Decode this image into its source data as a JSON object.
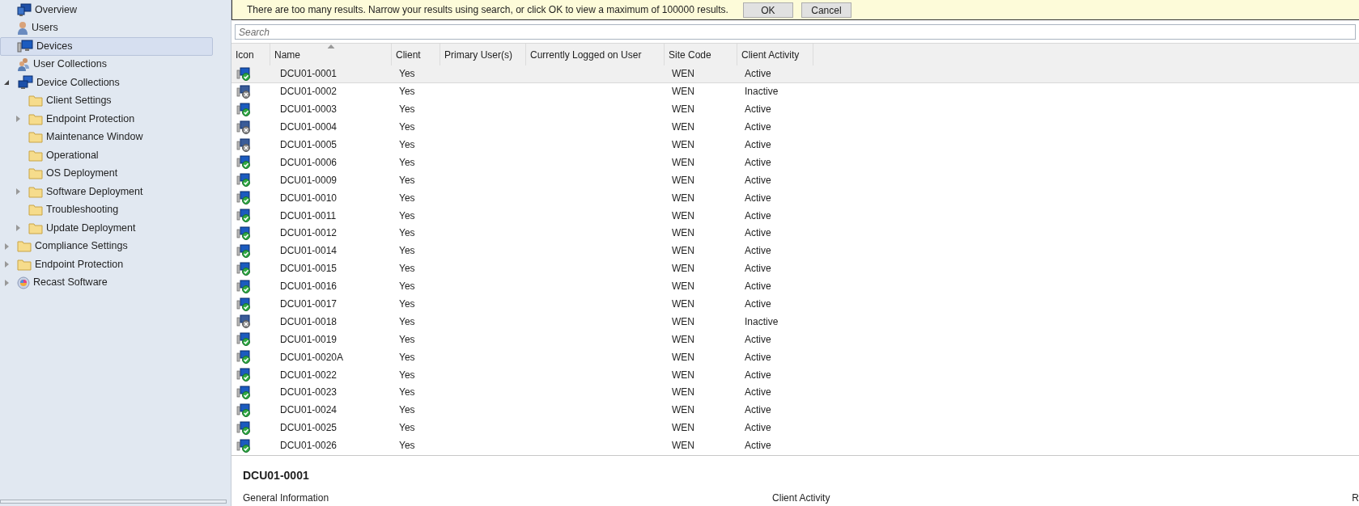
{
  "sidebar": {
    "items": [
      {
        "label": "Overview",
        "kind": "overview",
        "selected": false
      },
      {
        "label": "Users",
        "kind": "user",
        "selected": false
      },
      {
        "label": "Devices",
        "kind": "device",
        "selected": true
      },
      {
        "label": "User Collections",
        "kind": "user-collection",
        "selected": false
      },
      {
        "label": "Device Collections",
        "kind": "device-collection",
        "selected": false,
        "expanded": true,
        "children": [
          {
            "label": "Client Settings",
            "kind": "folder",
            "selected": false
          },
          {
            "label": "Endpoint Protection",
            "kind": "folder",
            "selected": false,
            "expanded": false
          },
          {
            "label": "Maintenance Window",
            "kind": "folder",
            "selected": false
          },
          {
            "label": "Operational",
            "kind": "folder",
            "selected": false
          },
          {
            "label": "OS Deployment",
            "kind": "folder",
            "selected": false
          },
          {
            "label": "Software Deployment",
            "kind": "folder",
            "selected": false,
            "expanded": false
          },
          {
            "label": "Troubleshooting",
            "kind": "folder",
            "selected": false
          },
          {
            "label": "Update Deployment",
            "kind": "folder",
            "selected": false,
            "expanded": false
          }
        ]
      },
      {
        "label": "Compliance Settings",
        "kind": "folder",
        "selected": false,
        "expanded": false
      },
      {
        "label": "Endpoint Protection",
        "kind": "folder",
        "selected": false,
        "expanded": false
      },
      {
        "label": "Recast Software",
        "kind": "recast",
        "selected": false,
        "expanded": false
      }
    ]
  },
  "notice": {
    "message": "There are too many results. Narrow your results using search, or click OK to view a maximum of 100000 results.",
    "buttons": [
      "OK",
      "Cancel"
    ]
  },
  "search": {
    "placeholder": "Search"
  },
  "table": {
    "columns": [
      {
        "label": "Icon",
        "sorted": false
      },
      {
        "label": "Name",
        "sorted": true
      },
      {
        "label": "Client",
        "sorted": false
      },
      {
        "label": "Primary User(s)",
        "sorted": false
      },
      {
        "label": "Currently Logged on User",
        "sorted": false
      },
      {
        "label": "Site Code",
        "sorted": false
      },
      {
        "label": "Client Activity",
        "sorted": false
      }
    ],
    "rows": [
      {
        "kind": "ok",
        "name": "DCU01-0001",
        "client": "Yes",
        "site_code": "WEN",
        "client_activity": "Active",
        "selected": true
      },
      {
        "kind": "error",
        "name": "DCU01-0002",
        "client": "Yes",
        "site_code": "WEN",
        "client_activity": "Inactive",
        "selected": false
      },
      {
        "kind": "ok",
        "name": "DCU01-0003",
        "client": "Yes",
        "site_code": "WEN",
        "client_activity": "Active",
        "selected": false
      },
      {
        "kind": "error",
        "name": "DCU01-0004",
        "client": "Yes",
        "site_code": "WEN",
        "client_activity": "Active",
        "selected": false
      },
      {
        "kind": "error",
        "name": "DCU01-0005",
        "client": "Yes",
        "site_code": "WEN",
        "client_activity": "Active",
        "selected": false
      },
      {
        "kind": "ok",
        "name": "DCU01-0006",
        "client": "Yes",
        "site_code": "WEN",
        "client_activity": "Active",
        "selected": false
      },
      {
        "kind": "ok",
        "name": "DCU01-0009",
        "client": "Yes",
        "site_code": "WEN",
        "client_activity": "Active",
        "selected": false
      },
      {
        "kind": "ok",
        "name": "DCU01-0010",
        "client": "Yes",
        "site_code": "WEN",
        "client_activity": "Active",
        "selected": false
      },
      {
        "kind": "ok",
        "name": "DCU01-0011",
        "client": "Yes",
        "site_code": "WEN",
        "client_activity": "Active",
        "selected": false
      },
      {
        "kind": "ok",
        "name": "DCU01-0012",
        "client": "Yes",
        "site_code": "WEN",
        "client_activity": "Active",
        "selected": false
      },
      {
        "kind": "ok",
        "name": "DCU01-0014",
        "client": "Yes",
        "site_code": "WEN",
        "client_activity": "Active",
        "selected": false
      },
      {
        "kind": "ok",
        "name": "DCU01-0015",
        "client": "Yes",
        "site_code": "WEN",
        "client_activity": "Active",
        "selected": false
      },
      {
        "kind": "ok",
        "name": "DCU01-0016",
        "client": "Yes",
        "site_code": "WEN",
        "client_activity": "Active",
        "selected": false
      },
      {
        "kind": "ok",
        "name": "DCU01-0017",
        "client": "Yes",
        "site_code": "WEN",
        "client_activity": "Active",
        "selected": false
      },
      {
        "kind": "error",
        "name": "DCU01-0018",
        "client": "Yes",
        "site_code": "WEN",
        "client_activity": "Inactive",
        "selected": false
      },
      {
        "kind": "ok",
        "name": "DCU01-0019",
        "client": "Yes",
        "site_code": "WEN",
        "client_activity": "Active",
        "selected": false
      },
      {
        "kind": "ok",
        "name": "DCU01-0020A",
        "client": "Yes",
        "site_code": "WEN",
        "client_activity": "Active",
        "selected": false
      },
      {
        "kind": "ok",
        "name": "DCU01-0022",
        "client": "Yes",
        "site_code": "WEN",
        "client_activity": "Active",
        "selected": false
      },
      {
        "kind": "ok",
        "name": "DCU01-0023",
        "client": "Yes",
        "site_code": "WEN",
        "client_activity": "Active",
        "selected": false
      },
      {
        "kind": "ok",
        "name": "DCU01-0024",
        "client": "Yes",
        "site_code": "WEN",
        "client_activity": "Active",
        "selected": false
      },
      {
        "kind": "ok",
        "name": "DCU01-0025",
        "client": "Yes",
        "site_code": "WEN",
        "client_activity": "Active",
        "selected": false
      },
      {
        "kind": "ok",
        "name": "DCU01-0026",
        "client": "Yes",
        "site_code": "WEN",
        "client_activity": "Active",
        "selected": false
      }
    ]
  },
  "details": {
    "title": "DCU01-0001",
    "sections": [
      "General Information",
      "Client Activity",
      "R"
    ]
  }
}
